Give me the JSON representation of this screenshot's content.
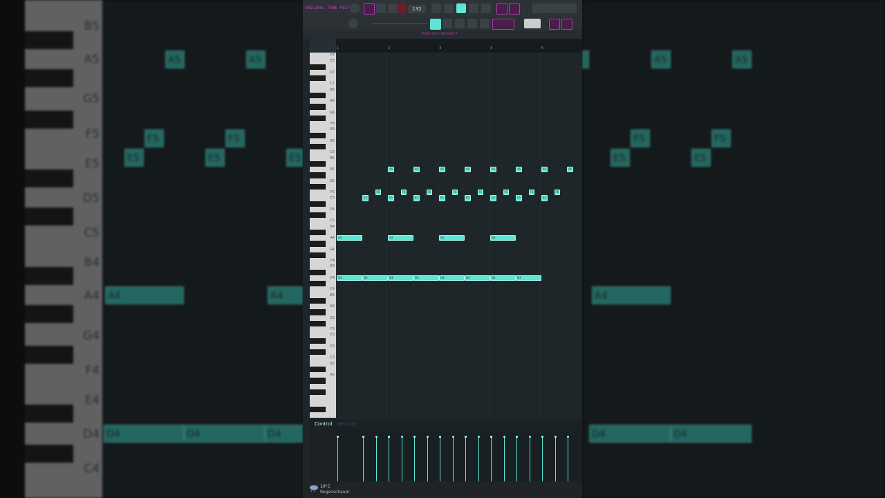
{
  "app": {
    "title": "ORIGINAL TUNE FEST",
    "tempo": "132",
    "pattern_title": "Piano roll - Kontakt 7"
  },
  "ruler": [
    "1",
    "2",
    "3",
    "4",
    "5"
  ],
  "keyboard_labels": [
    "F7",
    "E7",
    "D7",
    "C7",
    "B6",
    "A6",
    "G6",
    "F6",
    "E6",
    "D6",
    "C6",
    "B5",
    "A5",
    "G5",
    "F5",
    "E5",
    "D5",
    "C5",
    "B4",
    "A4",
    "G4",
    "F4",
    "E4",
    "D4",
    "C4",
    "B3",
    "A3",
    "G3",
    "F3",
    "E3",
    "D3",
    "C3",
    "B2",
    "A2"
  ],
  "notes": [
    {
      "pitch": "A5",
      "start": 1,
      "len": 0.12
    },
    {
      "pitch": "A5",
      "start": 1.5,
      "len": 0.12
    },
    {
      "pitch": "A5",
      "start": 2,
      "len": 0.12
    },
    {
      "pitch": "A5",
      "start": 2.5,
      "len": 0.12
    },
    {
      "pitch": "A5",
      "start": 3,
      "len": 0.12
    },
    {
      "pitch": "A5",
      "start": 3.5,
      "len": 0.12
    },
    {
      "pitch": "A5",
      "start": 4,
      "len": 0.12
    },
    {
      "pitch": "A5",
      "start": 4.5,
      "len": 0.12
    },
    {
      "pitch": "F5",
      "start": 0.75,
      "len": 0.12
    },
    {
      "pitch": "F5",
      "start": 1.25,
      "len": 0.12
    },
    {
      "pitch": "F5",
      "start": 1.75,
      "len": 0.12
    },
    {
      "pitch": "F5",
      "start": 2.25,
      "len": 0.12
    },
    {
      "pitch": "F5",
      "start": 2.75,
      "len": 0.12
    },
    {
      "pitch": "F5",
      "start": 3.25,
      "len": 0.12
    },
    {
      "pitch": "F5",
      "start": 3.75,
      "len": 0.12
    },
    {
      "pitch": "F5",
      "start": 4.25,
      "len": 0.12
    },
    {
      "pitch": "E5",
      "start": 0.5,
      "len": 0.12
    },
    {
      "pitch": "E5",
      "start": 1,
      "len": 0.12
    },
    {
      "pitch": "E5",
      "start": 1.5,
      "len": 0.12
    },
    {
      "pitch": "E5",
      "start": 2,
      "len": 0.12
    },
    {
      "pitch": "E5",
      "start": 2.5,
      "len": 0.12
    },
    {
      "pitch": "E5",
      "start": 3,
      "len": 0.12
    },
    {
      "pitch": "E5",
      "start": 3.5,
      "len": 0.12
    },
    {
      "pitch": "E5",
      "start": 4,
      "len": 0.12
    },
    {
      "pitch": "A4",
      "start": 0,
      "len": 0.5
    },
    {
      "pitch": "A4",
      "start": 1,
      "len": 0.5
    },
    {
      "pitch": "A4",
      "start": 2,
      "len": 0.5
    },
    {
      "pitch": "A4",
      "start": 3,
      "len": 0.5
    },
    {
      "pitch": "D4",
      "start": 0,
      "len": 0.5
    },
    {
      "pitch": "D4",
      "start": 0.5,
      "len": 0.5
    },
    {
      "pitch": "D4",
      "start": 1,
      "len": 0.5
    },
    {
      "pitch": "D4",
      "start": 1.5,
      "len": 0.5
    },
    {
      "pitch": "D4",
      "start": 2,
      "len": 0.5
    },
    {
      "pitch": "D4",
      "start": 2.5,
      "len": 0.5
    },
    {
      "pitch": "D4",
      "start": 3,
      "len": 0.5
    },
    {
      "pitch": "D4",
      "start": 3.5,
      "len": 0.5
    }
  ],
  "control": {
    "label": "Control",
    "sub": "Velocity"
  },
  "taskbar": {
    "temp": "10°C",
    "condition": "Regenschauer"
  },
  "colors": {
    "note": "#5ee5d4",
    "accent": "#b33ab3"
  }
}
